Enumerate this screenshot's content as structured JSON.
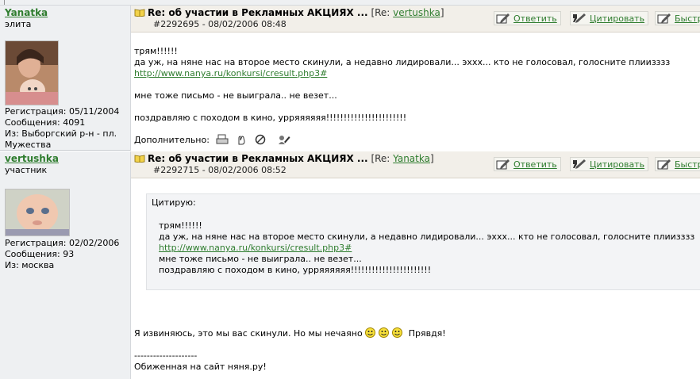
{
  "colors": {
    "link": "#2f7d2f",
    "panel": "#eef0f2",
    "header": "#f2efe9",
    "quote_bg": "#f3f4f6"
  },
  "posts": [
    {
      "username": "Yanatka",
      "rank": "элита",
      "info": {
        "registration": "Регистрация: 05/11/2004",
        "messages": "Сообщения: 4091",
        "location": "Из: Выборгский р-н - пл. Мужества"
      },
      "subject": "Re: об участии в Рекламных АКЦИЯХ ...",
      "re_prefix": "[Re:",
      "re_user": "vertushka",
      "re_suffix": "]",
      "post_number": "#2292695 - 08/02/2006 08:48",
      "buttons": {
        "reply": "Ответить",
        "quote": "Цитировать",
        "quick": "Быстр"
      },
      "body": {
        "l1": "трям!!!!!!",
        "l2": "да уж, на няне нас на второе место скинули, а недавно лидировали... эххх... кто не голосовал, голосните плиизззз",
        "link": "http://www.nanya.ru/konkursi/cresult.php3#",
        "l3": "мне тоже письмо - не выиграла.. не везет...",
        "l4": "поздравляю с походом в кино, урряяяяяя!!!!!!!!!!!!!!!!!!!!!!!"
      },
      "extras_label": "Дополнительно:"
    },
    {
      "username": "vertushka",
      "rank": "участник",
      "info": {
        "registration": "Регистрация: 02/02/2006",
        "messages": "Сообщения: 93",
        "location": "Из: москва"
      },
      "subject": "Re: об участии в Рекламных АКЦИЯХ ...",
      "re_prefix": "[Re:",
      "re_user": "Yanatka",
      "re_suffix": "]",
      "post_number": "#2292715 - 08/02/2006 08:52",
      "buttons": {
        "reply": "Ответить",
        "quote": "Цитировать",
        "quick": "Быстр"
      },
      "quote": {
        "label": "Цитирую:",
        "l1": "трям!!!!!!",
        "l2": "да уж, на няне нас на второе место скинули, а недавно лидировали... эххх... кто не голосовал, голосните плиизззз",
        "link": "http://www.nanya.ru/konkursi/cresult.php3#",
        "l3": "мне тоже письмо - не выиграла.. не везет...",
        "l4": "поздравляю с походом в кино, урряяяяяя!!!!!!!!!!!!!!!!!!!!!!!"
      },
      "body": {
        "text": "Я извиняюсь, это мы вас скинули. Но мы нечаяно",
        "after": "Прявдя!",
        "divider": "--------------------",
        "signature": "Обиженная на сайт няня.ру!"
      }
    }
  ]
}
